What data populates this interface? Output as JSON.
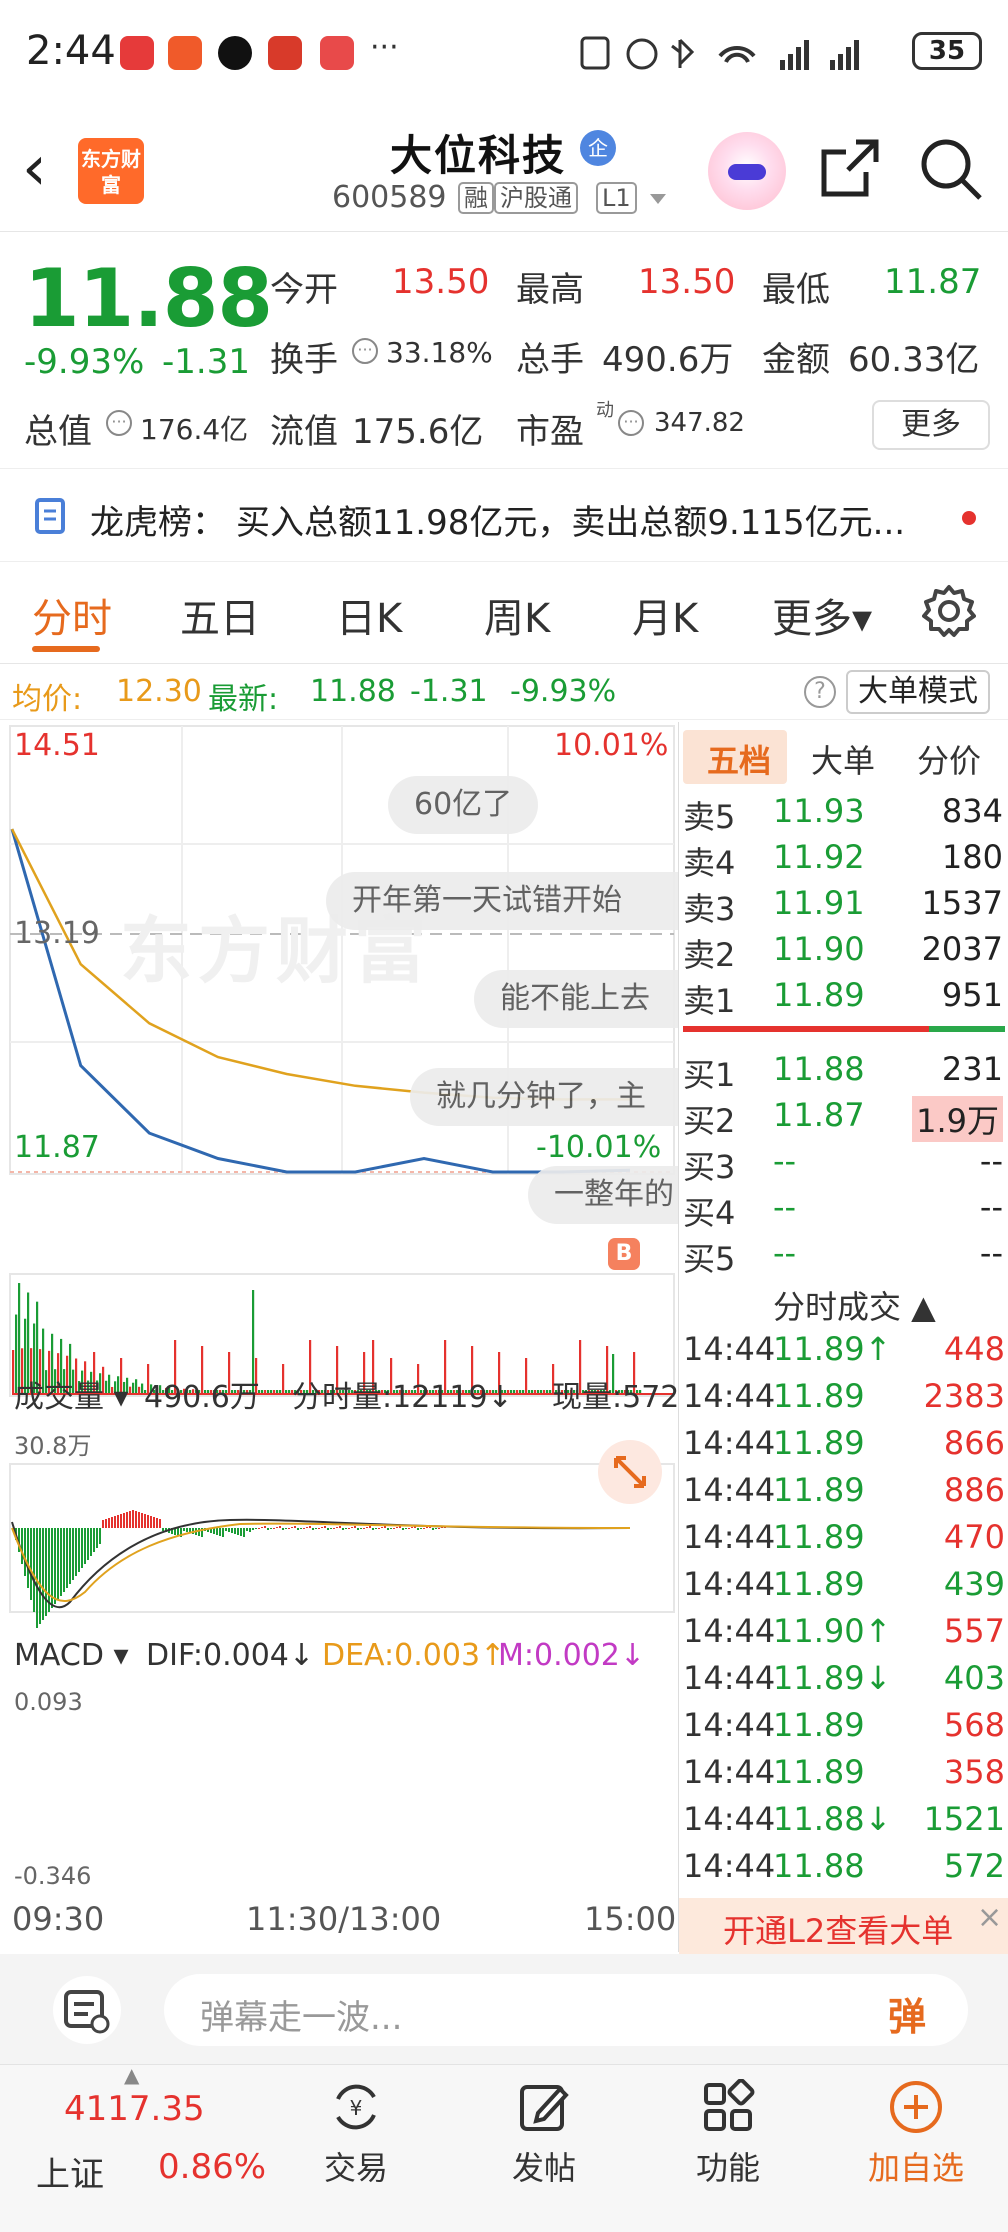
{
  "status_bar": {
    "time": "2:44",
    "battery": "35",
    "more": "···"
  },
  "header": {
    "title": "大位科技",
    "badge": "企",
    "logo_text": "东方财富",
    "code": "600589",
    "tags": [
      "融",
      "沪股通",
      "L1"
    ],
    "back_icon": "chevron-left-icon",
    "share_icon": "share-icon",
    "search_icon": "search-icon"
  },
  "quote": {
    "price": "11.88",
    "change_pct": "-9.93%",
    "change": "-1.31",
    "open_label": "今开",
    "open": "13.50",
    "high_label": "最高",
    "high": "13.50",
    "low_label": "最低",
    "low": "11.87",
    "turnover_label": "换手",
    "turnover": "33.18%",
    "volume_label": "总手",
    "volume": "490.6万",
    "amount_label": "金额",
    "amount": "60.33亿",
    "mktcap_label": "总值",
    "mktcap": "176.4亿",
    "float_label": "流值",
    "float": "175.6亿",
    "pe_label": "市盈",
    "pe_sup": "动",
    "pe": "347.82",
    "more": "更多"
  },
  "dragon": {
    "label": "龙虎榜：",
    "text": "买入总额11.98亿元，卖出总额9.115亿元..."
  },
  "tabs": [
    "分时",
    "五日",
    "日K",
    "周K",
    "月K",
    "更多▾"
  ],
  "avg_line": {
    "avg_label": "均价:",
    "avg": "12.30",
    "latest_label": "最新:",
    "latest": "11.88",
    "chg": "-1.31",
    "pct": "-9.93%",
    "mode_btn": "大单模式"
  },
  "chart": {
    "price_top": "14.51",
    "pct_top": "10.01%",
    "price_mid": "13.19",
    "price_bottom": "11.87",
    "pct_bottom": "-10.01%",
    "watermark": "东方财富",
    "b_marker": "B",
    "danmu": [
      "60亿了",
      "开年第一天试错开始",
      "能不能上去",
      "就几分钟了，主",
      "一整年的"
    ],
    "vol_label": "成交量 ▾",
    "vol_total": "490.6万",
    "vol_min_label": "分时量:12119↓",
    "vol_now_label": "现量:572",
    "vol_max": "30.8万",
    "macd_label": "MACD ▾",
    "dif": "DIF:0.004↓",
    "dea": "DEA:0.003↑",
    "m": "M:0.002↓",
    "macd_top": "0.093",
    "macd_bottom": "-0.346",
    "time_start": "09:30",
    "time_mid": "11:30/13:00",
    "time_end": "15:00"
  },
  "chart_data": {
    "type": "line",
    "x": [
      "09:30",
      "11:30/13:00",
      "15:00"
    ],
    "ylim": [
      11.87,
      14.51
    ],
    "series": [
      {
        "values": [
          13.9,
          12.5,
          12.1,
          11.95,
          11.87,
          11.87,
          11.95,
          11.87,
          11.87,
          11.88
        ]
      },
      {
        "values": [
          13.9,
          13.1,
          12.75,
          12.55,
          12.45,
          12.38,
          12.34,
          12.31,
          12.3,
          12.3
        ]
      }
    ]
  },
  "book": {
    "tabs": [
      "五档",
      "大单",
      "分价"
    ],
    "sells": [
      {
        "label": "卖5",
        "price": "11.93",
        "vol": "834"
      },
      {
        "label": "卖4",
        "price": "11.92",
        "vol": "180"
      },
      {
        "label": "卖3",
        "price": "11.91",
        "vol": "1537"
      },
      {
        "label": "卖2",
        "price": "11.90",
        "vol": "2037"
      },
      {
        "label": "卖1",
        "price": "11.89",
        "vol": "951"
      }
    ],
    "buys": [
      {
        "label": "买1",
        "price": "11.88",
        "vol": "231"
      },
      {
        "label": "买2",
        "price": "11.87",
        "vol": "1.9万"
      },
      {
        "label": "买3",
        "price": "--",
        "vol": "--"
      },
      {
        "label": "买4",
        "price": "--",
        "vol": "--"
      },
      {
        "label": "买5",
        "price": "--",
        "vol": "--"
      }
    ],
    "trades_title": "分时成交 ▲",
    "trades": [
      {
        "t": "14:44",
        "p": "11.89↑",
        "v": "448",
        "c": "red"
      },
      {
        "t": "14:44",
        "p": "11.89",
        "v": "2383",
        "c": "red"
      },
      {
        "t": "14:44",
        "p": "11.89",
        "v": "866",
        "c": "red"
      },
      {
        "t": "14:44",
        "p": "11.89",
        "v": "886",
        "c": "red"
      },
      {
        "t": "14:44",
        "p": "11.89",
        "v": "470",
        "c": "red"
      },
      {
        "t": "14:44",
        "p": "11.89",
        "v": "439",
        "c": "green"
      },
      {
        "t": "14:44",
        "p": "11.90↑",
        "v": "557",
        "c": "red"
      },
      {
        "t": "14:44",
        "p": "11.89↓",
        "v": "403",
        "c": "green"
      },
      {
        "t": "14:44",
        "p": "11.89",
        "v": "568",
        "c": "red"
      },
      {
        "t": "14:44",
        "p": "11.89",
        "v": "358",
        "c": "red"
      },
      {
        "t": "14:44",
        "p": "11.88↓",
        "v": "1521",
        "c": "green"
      },
      {
        "t": "14:44",
        "p": "11.88",
        "v": "572",
        "c": "green"
      }
    ],
    "l2_banner": "开通L2查看大单"
  },
  "comment": {
    "placeholder": "弹幕走一波...",
    "danmu_btn": "弹"
  },
  "bottom_nav": {
    "index_value": "4117.35",
    "index_name": "上证",
    "index_pct": "0.86%",
    "items": [
      "交易",
      "发帖",
      "功能",
      "加自选"
    ]
  }
}
